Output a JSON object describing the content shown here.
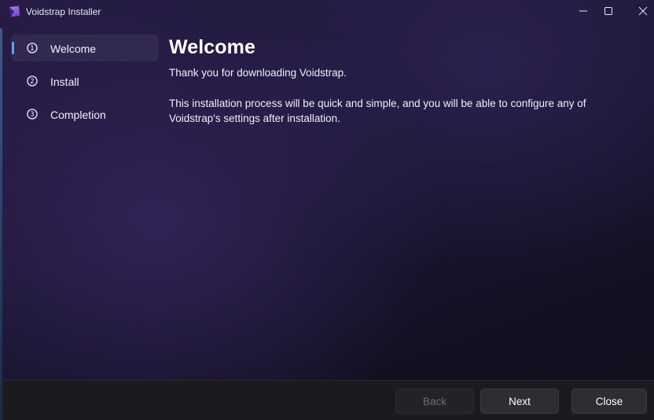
{
  "window": {
    "title": "Voidstrap Installer",
    "icon": "voidstrap-logo-icon",
    "controls": [
      "minimize-icon",
      "maximize-icon",
      "close-icon"
    ]
  },
  "sidebar": {
    "items": [
      {
        "number": "1",
        "label": "Welcome",
        "active": true
      },
      {
        "number": "2",
        "label": "Install",
        "active": false
      },
      {
        "number": "3",
        "label": "Completion",
        "active": false
      }
    ]
  },
  "content": {
    "title": "Welcome",
    "intro": "Thank you for downloading Voidstrap.",
    "body": "This installation process will be quick and simple, and you will be able to configure any of Voidstrap's settings after installation."
  },
  "footer": {
    "back_label": "Back",
    "next_label": "Next",
    "close_label": "Close",
    "back_enabled": false
  },
  "colors": {
    "accent": "#5aa2e8",
    "background": "#1b1533",
    "footer": "#1b1b1f"
  }
}
